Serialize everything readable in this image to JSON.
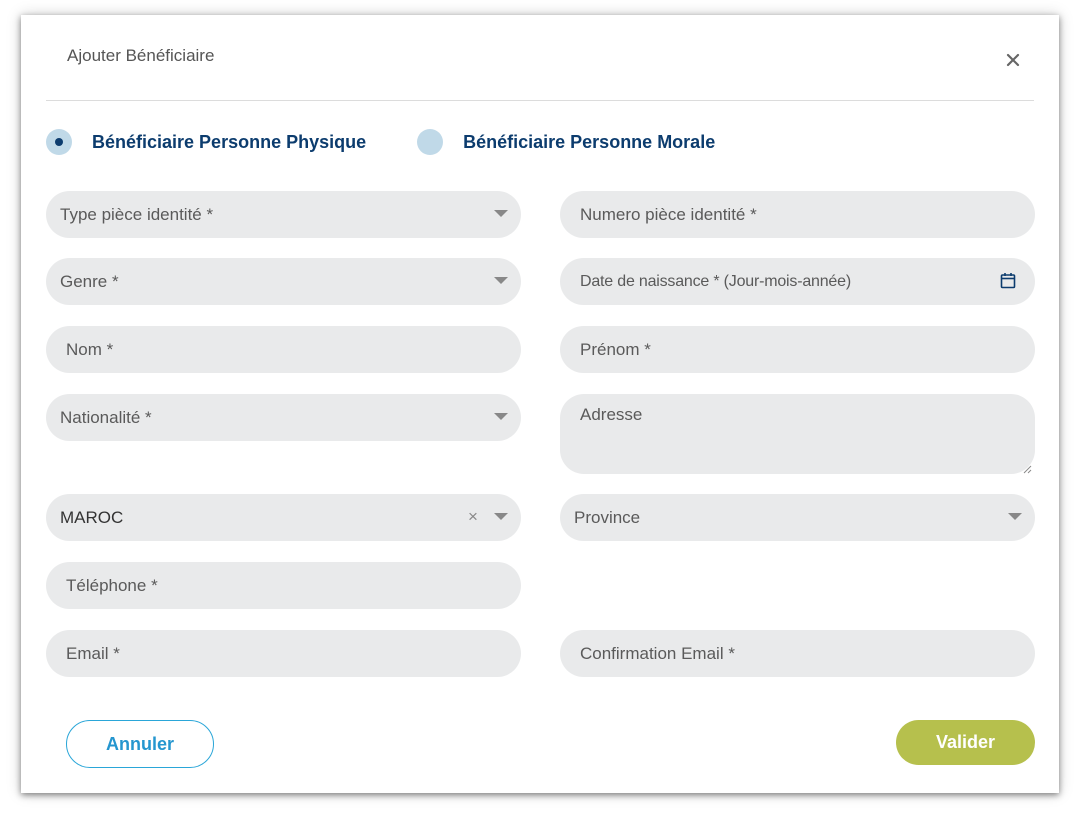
{
  "modal": {
    "title": "Ajouter Bénéficiaire",
    "close_icon": "close-icon"
  },
  "beneficiary_type": {
    "options": [
      {
        "label": "Bénéficiaire Personne Physique",
        "selected": true
      },
      {
        "label": "Bénéficiaire Personne Morale",
        "selected": false
      }
    ]
  },
  "form": {
    "type_piece": {
      "placeholder": "Type pièce identité *"
    },
    "numero_piece": {
      "placeholder": "Numero pièce identité *"
    },
    "genre": {
      "placeholder": "Genre *"
    },
    "date_naissance": {
      "placeholder": "Date de naissance * (Jour-mois-année)",
      "icon": "calendar-icon"
    },
    "nom": {
      "placeholder": "Nom *"
    },
    "prenom": {
      "placeholder": "Prénom *"
    },
    "nationalite": {
      "placeholder": "Nationalité *"
    },
    "adresse": {
      "placeholder": "Adresse"
    },
    "pays": {
      "value": "MAROC",
      "clear_symbol": "×"
    },
    "province": {
      "placeholder": "Province"
    },
    "telephone": {
      "placeholder": "Téléphone *"
    },
    "email": {
      "placeholder": "Email *"
    },
    "confirmation_email": {
      "placeholder": "Confirmation Email *"
    }
  },
  "actions": {
    "cancel_label": "Annuler",
    "validate_label": "Valider"
  },
  "colors": {
    "primary_navy": "#0c3c6e",
    "radio_fill": "#c0d9e8",
    "field_bg": "#e9eaeb",
    "cancel_blue": "#2596cf",
    "validate_green": "#b6c04d"
  }
}
